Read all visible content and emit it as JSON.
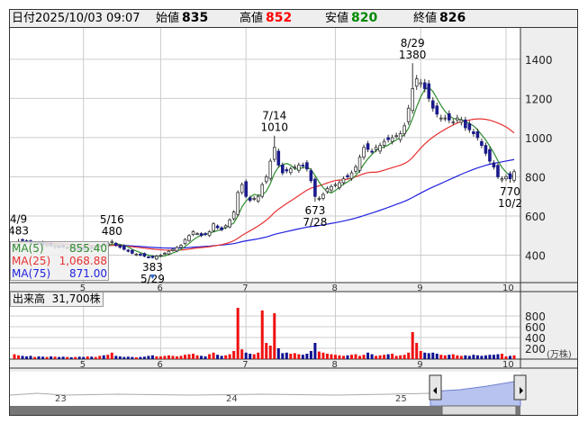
{
  "header": {
    "date_label": "日付",
    "date": "2025/10/03 09:07",
    "open_label": "始値",
    "open": "835",
    "high_label": "高値",
    "high": "852",
    "low_label": "安値",
    "low": "820",
    "close_label": "終値",
    "close": "826"
  },
  "legend": [
    {
      "name": "MA(5)",
      "value": "855.40",
      "color": "#2e8b2e"
    },
    {
      "name": "MA(25)",
      "value": "1,068.88",
      "color": "#e83030"
    },
    {
      "name": "MA(75)",
      "value": "871.00",
      "color": "#2020e0"
    }
  ],
  "volume_header": {
    "label": "出来高",
    "value": "31,700株"
  },
  "volume_unit": "(万株)",
  "navigator_labels": [
    "23",
    "24",
    "25"
  ],
  "chart_data": {
    "type": "candlestick",
    "months": [
      "5",
      "6",
      "7",
      "8",
      "9",
      "10"
    ],
    "month_start_index": [
      17,
      36,
      57,
      79,
      100,
      121
    ],
    "price_ticks": [
      400,
      600,
      800,
      1000,
      1200,
      1400
    ],
    "price_range": [
      260,
      1560
    ],
    "volume_ticks": [
      200,
      400,
      600,
      800
    ],
    "volume_range": [
      0,
      1000
    ],
    "closes": [
      455,
      470,
      478,
      468,
      462,
      465,
      458,
      452,
      455,
      448,
      445,
      440,
      442,
      438,
      435,
      432,
      430,
      432,
      436,
      440,
      445,
      450,
      455,
      460,
      470,
      450,
      440,
      430,
      420,
      410,
      405,
      400,
      395,
      390,
      388,
      395,
      400,
      410,
      420,
      430,
      440,
      450,
      480,
      500,
      520,
      510,
      500,
      505,
      520,
      560,
      540,
      530,
      550,
      580,
      620,
      720,
      760,
      700,
      680,
      690,
      700,
      760,
      800,
      880,
      950,
      860,
      820,
      830,
      840,
      850,
      860,
      855,
      840,
      780,
      700,
      690,
      710,
      740,
      750,
      760,
      770,
      790,
      800,
      820,
      850,
      900,
      950,
      940,
      930,
      950,
      960,
      980,
      990,
      1000,
      1010,
      1020,
      1060,
      1150,
      1250,
      1300,
      1280,
      1250,
      1200,
      1150,
      1120,
      1100,
      1100,
      1090,
      1080,
      1100,
      1090,
      1050,
      1040,
      1020,
      1000,
      960,
      920,
      880,
      850,
      800,
      790,
      800,
      790,
      826
    ],
    "volumes": [
      90,
      70,
      60,
      50,
      60,
      40,
      50,
      45,
      40,
      50,
      45,
      40,
      45,
      40,
      35,
      40,
      45,
      40,
      50,
      45,
      40,
      60,
      70,
      80,
      120,
      60,
      50,
      40,
      45,
      40,
      35,
      40,
      45,
      60,
      70,
      50,
      50,
      60,
      70,
      60,
      50,
      60,
      80,
      90,
      100,
      70,
      60,
      50,
      90,
      120,
      80,
      60,
      70,
      90,
      150,
      950,
      180,
      120,
      100,
      90,
      120,
      900,
      300,
      250,
      850,
      200,
      110,
      120,
      100,
      110,
      90,
      80,
      100,
      150,
      300,
      140,
      120,
      100,
      90,
      80,
      70,
      60,
      70,
      80,
      90,
      60,
      80,
      120,
      90,
      60,
      70,
      80,
      90,
      100,
      60,
      70,
      80,
      120,
      500,
      300,
      150,
      120,
      110,
      120,
      100,
      80,
      70,
      80,
      90,
      70,
      60,
      70,
      60,
      80,
      70,
      60,
      70,
      80,
      80,
      90,
      100,
      50,
      60,
      70,
      50
    ],
    "annotations": [
      {
        "index": 1,
        "price": 483,
        "date": "4/9",
        "pos": "above"
      },
      {
        "index": 24,
        "price": 480,
        "date": "5/16",
        "pos": "above"
      },
      {
        "index": 34,
        "price": 383,
        "date": "5/29",
        "pos": "below"
      },
      {
        "index": 64,
        "price": 1010,
        "date": "7/14",
        "pos": "above"
      },
      {
        "index": 74,
        "price": 673,
        "date": "7/28",
        "pos": "below"
      },
      {
        "index": 98,
        "price": 1380,
        "date": "8/29",
        "pos": "above"
      },
      {
        "index": 122,
        "price": 770,
        "date": "10/2",
        "pos": "below"
      }
    ]
  }
}
